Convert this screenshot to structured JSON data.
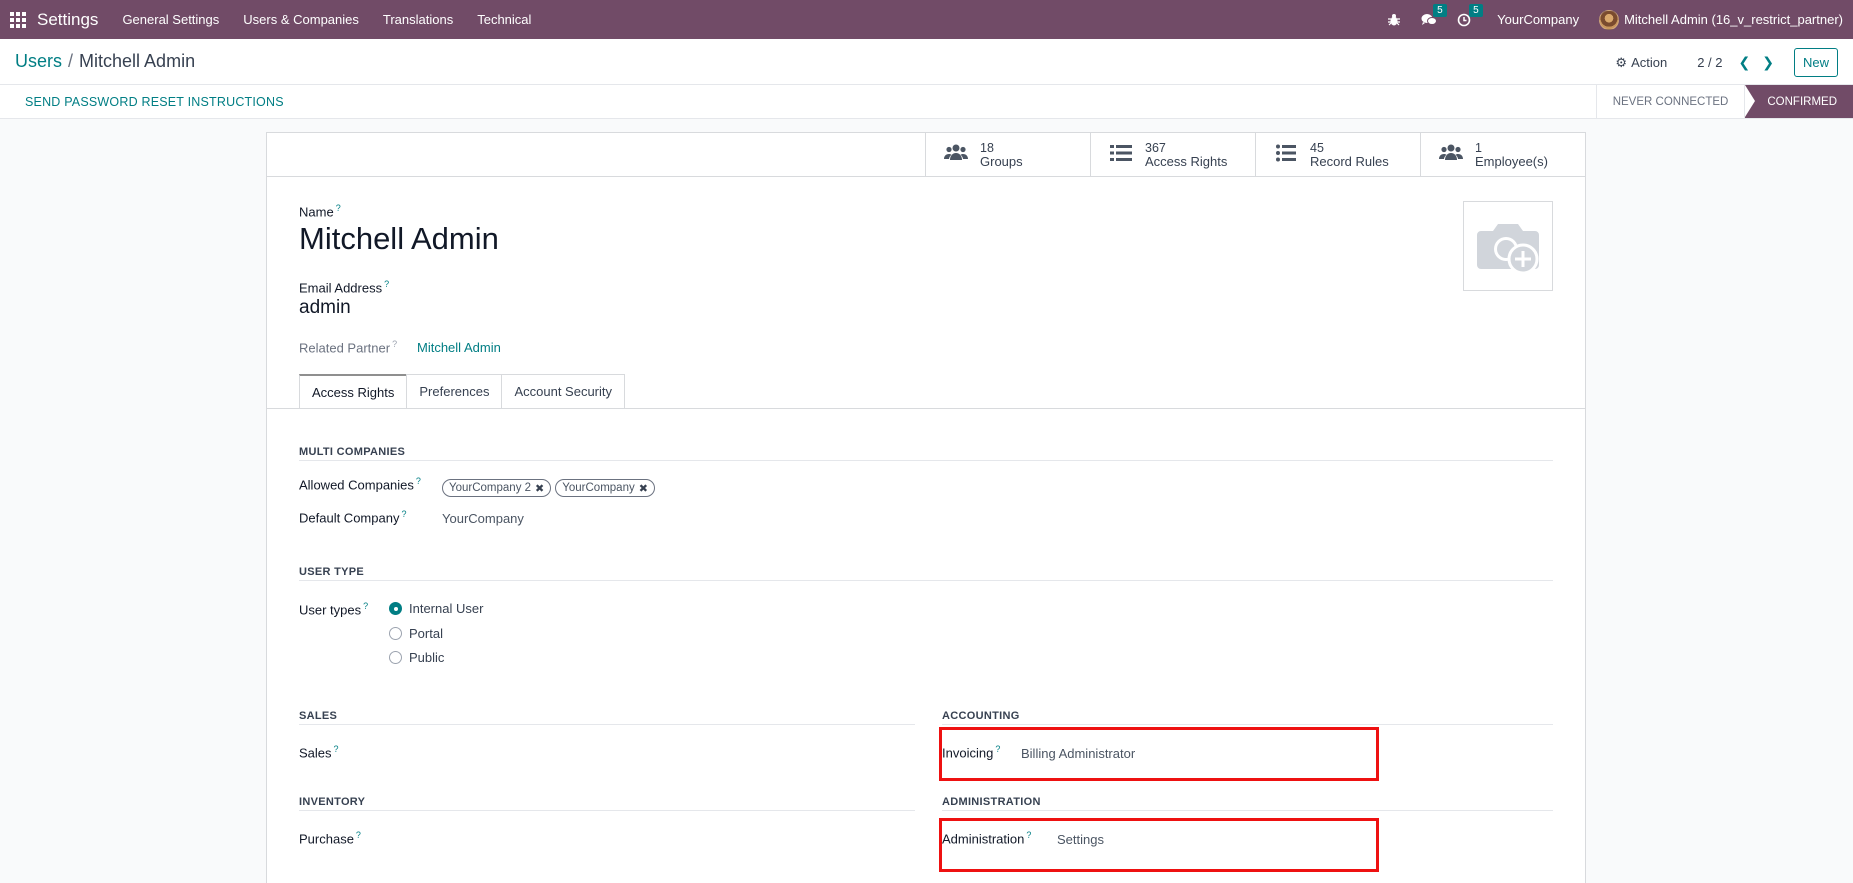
{
  "navbar": {
    "app_name": "Settings",
    "menu": [
      "General Settings",
      "Users & Companies",
      "Translations",
      "Technical"
    ],
    "messages_count": "5",
    "activities_count": "5",
    "company": "YourCompany",
    "user": "Mitchell Admin (16_v_restrict_partner)"
  },
  "control": {
    "breadcrumb_parent": "Users",
    "breadcrumb_separator": "/",
    "breadcrumb_current": "Mitchell Admin",
    "action_label": "Action",
    "pager": "2 / 2",
    "new_label": "New"
  },
  "statusbar": {
    "reset_button": "SEND PASSWORD RESET INSTRUCTIONS",
    "stages": [
      "NEVER CONNECTED",
      "CONFIRMED"
    ],
    "active_stage": "CONFIRMED"
  },
  "stat_buttons": [
    {
      "value": "18",
      "label": "Groups",
      "icon": "users-icon"
    },
    {
      "value": "367",
      "label": "Access Rights",
      "icon": "list-icon"
    },
    {
      "value": "45",
      "label": "Record Rules",
      "icon": "list-bullets-icon"
    },
    {
      "value": "1",
      "label": "Employee(s)",
      "icon": "users-icon"
    }
  ],
  "form": {
    "name_label": "Name",
    "name": "Mitchell Admin",
    "email_label": "Email Address",
    "email": "admin",
    "partner_label": "Related Partner",
    "partner": "Mitchell Admin"
  },
  "tabs": [
    "Access Rights",
    "Preferences",
    "Account Security"
  ],
  "access": {
    "multi_companies_title": "MULTI COMPANIES",
    "allowed_companies_label": "Allowed Companies",
    "allowed_companies": [
      "YourCompany 2",
      "YourCompany"
    ],
    "default_company_label": "Default Company",
    "default_company": "YourCompany",
    "user_type_title": "USER TYPE",
    "user_types_label": "User types",
    "user_types": [
      "Internal User",
      "Portal",
      "Public"
    ],
    "selected_user_type": "Internal User",
    "sales_title": "SALES",
    "sales_label": "Sales",
    "inventory_title": "INVENTORY",
    "purchase_label": "Purchase",
    "accounting_title": "ACCOUNTING",
    "invoicing_label": "Invoicing",
    "invoicing_value": "Billing Administrator",
    "administration_title": "ADMINISTRATION",
    "administration_label": "Administration",
    "administration_value": "Settings"
  },
  "colors": {
    "brand": "#714b67",
    "accent": "#017e84",
    "highlight": "#ee1111"
  }
}
